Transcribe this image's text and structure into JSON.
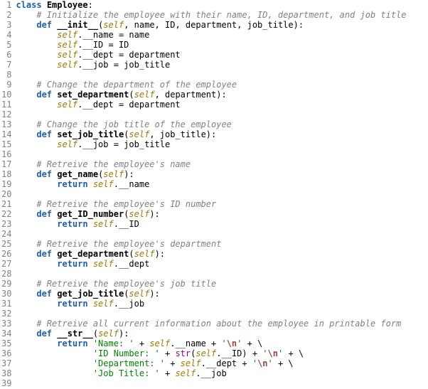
{
  "lines": [
    {
      "num": "1",
      "tokens": [
        [
          "kw",
          "class "
        ],
        [
          "cls",
          "Employee"
        ],
        [
          "plain",
          ":"
        ]
      ]
    },
    {
      "num": "2",
      "tokens": [
        [
          "plain",
          "    "
        ],
        [
          "cmt",
          "# Initialize the employee with their name, ID, department, and job title"
        ]
      ]
    },
    {
      "num": "3",
      "tokens": [
        [
          "plain",
          "    "
        ],
        [
          "kw",
          "def "
        ],
        [
          "fn",
          "__init__"
        ],
        [
          "plain",
          "("
        ],
        [
          "self",
          "self"
        ],
        [
          "plain",
          ", name, ID, department, job_title):"
        ]
      ]
    },
    {
      "num": "4",
      "tokens": [
        [
          "plain",
          "        "
        ],
        [
          "self",
          "self"
        ],
        [
          "plain",
          ".__name = name"
        ]
      ]
    },
    {
      "num": "5",
      "tokens": [
        [
          "plain",
          "        "
        ],
        [
          "self",
          "self"
        ],
        [
          "plain",
          ".__ID = ID"
        ]
      ]
    },
    {
      "num": "6",
      "tokens": [
        [
          "plain",
          "        "
        ],
        [
          "self",
          "self"
        ],
        [
          "plain",
          ".__dept = department"
        ]
      ]
    },
    {
      "num": "7",
      "tokens": [
        [
          "plain",
          "        "
        ],
        [
          "self",
          "self"
        ],
        [
          "plain",
          ".__job = job_title"
        ]
      ]
    },
    {
      "num": "8",
      "tokens": [
        [
          "plain",
          ""
        ]
      ]
    },
    {
      "num": "9",
      "tokens": [
        [
          "plain",
          "    "
        ],
        [
          "cmt",
          "# Change the department of the employee"
        ]
      ]
    },
    {
      "num": "10",
      "tokens": [
        [
          "plain",
          "    "
        ],
        [
          "kw",
          "def "
        ],
        [
          "fn",
          "set_department"
        ],
        [
          "plain",
          "("
        ],
        [
          "self",
          "self"
        ],
        [
          "plain",
          ", department):"
        ]
      ]
    },
    {
      "num": "11",
      "tokens": [
        [
          "plain",
          "        "
        ],
        [
          "self",
          "self"
        ],
        [
          "plain",
          ".__dept = department"
        ]
      ]
    },
    {
      "num": "12",
      "tokens": [
        [
          "plain",
          ""
        ]
      ]
    },
    {
      "num": "13",
      "tokens": [
        [
          "plain",
          "    "
        ],
        [
          "cmt",
          "# Change the job title of the employee"
        ]
      ]
    },
    {
      "num": "14",
      "tokens": [
        [
          "plain",
          "    "
        ],
        [
          "kw",
          "def "
        ],
        [
          "fn",
          "set_job_title"
        ],
        [
          "plain",
          "("
        ],
        [
          "self",
          "self"
        ],
        [
          "plain",
          ", job_title):"
        ]
      ]
    },
    {
      "num": "15",
      "tokens": [
        [
          "plain",
          "        "
        ],
        [
          "self",
          "self"
        ],
        [
          "plain",
          ".__job = job_title"
        ]
      ]
    },
    {
      "num": "16",
      "tokens": [
        [
          "plain",
          ""
        ]
      ]
    },
    {
      "num": "17",
      "tokens": [
        [
          "plain",
          "    "
        ],
        [
          "cmt",
          "# Retreive the employee's name"
        ]
      ]
    },
    {
      "num": "18",
      "tokens": [
        [
          "plain",
          "    "
        ],
        [
          "kw",
          "def "
        ],
        [
          "fn",
          "get_name"
        ],
        [
          "plain",
          "("
        ],
        [
          "self",
          "self"
        ],
        [
          "plain",
          "):"
        ]
      ]
    },
    {
      "num": "19",
      "tokens": [
        [
          "plain",
          "        "
        ],
        [
          "kw",
          "return "
        ],
        [
          "self",
          "self"
        ],
        [
          "plain",
          ".__name"
        ]
      ]
    },
    {
      "num": "20",
      "tokens": [
        [
          "plain",
          ""
        ]
      ]
    },
    {
      "num": "21",
      "tokens": [
        [
          "plain",
          "    "
        ],
        [
          "cmt",
          "# Retreive the employee's ID number"
        ]
      ]
    },
    {
      "num": "22",
      "tokens": [
        [
          "plain",
          "    "
        ],
        [
          "kw",
          "def "
        ],
        [
          "fn",
          "get_ID_number"
        ],
        [
          "plain",
          "("
        ],
        [
          "self",
          "self"
        ],
        [
          "plain",
          "):"
        ]
      ]
    },
    {
      "num": "23",
      "tokens": [
        [
          "plain",
          "        "
        ],
        [
          "kw",
          "return "
        ],
        [
          "self",
          "self"
        ],
        [
          "plain",
          ".__ID"
        ]
      ]
    },
    {
      "num": "24",
      "tokens": [
        [
          "plain",
          ""
        ]
      ]
    },
    {
      "num": "25",
      "tokens": [
        [
          "plain",
          "    "
        ],
        [
          "cmt",
          "# Retreive the employee's department"
        ]
      ]
    },
    {
      "num": "26",
      "tokens": [
        [
          "plain",
          "    "
        ],
        [
          "kw",
          "def "
        ],
        [
          "fn",
          "get_department"
        ],
        [
          "plain",
          "("
        ],
        [
          "self",
          "self"
        ],
        [
          "plain",
          "):"
        ]
      ]
    },
    {
      "num": "27",
      "tokens": [
        [
          "plain",
          "        "
        ],
        [
          "kw",
          "return "
        ],
        [
          "self",
          "self"
        ],
        [
          "plain",
          ".__dept"
        ]
      ]
    },
    {
      "num": "28",
      "tokens": [
        [
          "plain",
          ""
        ]
      ]
    },
    {
      "num": "29",
      "tokens": [
        [
          "plain",
          "    "
        ],
        [
          "cmt",
          "# Retreive the employee's job title"
        ]
      ]
    },
    {
      "num": "30",
      "tokens": [
        [
          "plain",
          "    "
        ],
        [
          "kw",
          "def "
        ],
        [
          "fn",
          "get_job_title"
        ],
        [
          "plain",
          "("
        ],
        [
          "self",
          "self"
        ],
        [
          "plain",
          "):"
        ]
      ]
    },
    {
      "num": "31",
      "tokens": [
        [
          "plain",
          "        "
        ],
        [
          "kw",
          "return "
        ],
        [
          "self",
          "self"
        ],
        [
          "plain",
          ".__job"
        ]
      ]
    },
    {
      "num": "32",
      "tokens": [
        [
          "plain",
          ""
        ]
      ]
    },
    {
      "num": "33",
      "tokens": [
        [
          "plain",
          "    "
        ],
        [
          "cmt",
          "# Retreive all current information about the employee in printable form"
        ]
      ]
    },
    {
      "num": "34",
      "tokens": [
        [
          "plain",
          "    "
        ],
        [
          "kw",
          "def "
        ],
        [
          "fn",
          "__str__"
        ],
        [
          "plain",
          "("
        ],
        [
          "self",
          "self"
        ],
        [
          "plain",
          "):"
        ]
      ]
    },
    {
      "num": "35",
      "tokens": [
        [
          "plain",
          "        "
        ],
        [
          "kw",
          "return "
        ],
        [
          "str",
          "'Name: '"
        ],
        [
          "plain",
          " + "
        ],
        [
          "self",
          "self"
        ],
        [
          "plain",
          ".__name + "
        ],
        [
          "str",
          "'"
        ],
        [
          "esc",
          "\\n"
        ],
        [
          "str",
          "'"
        ],
        [
          "plain",
          " + \\"
        ]
      ]
    },
    {
      "num": "36",
      "tokens": [
        [
          "plain",
          "               "
        ],
        [
          "str",
          "'ID Number: '"
        ],
        [
          "plain",
          " + "
        ],
        [
          "builtin",
          "str"
        ],
        [
          "plain",
          "("
        ],
        [
          "self",
          "self"
        ],
        [
          "plain",
          ".__ID) + "
        ],
        [
          "str",
          "'"
        ],
        [
          "esc",
          "\\n"
        ],
        [
          "str",
          "'"
        ],
        [
          "plain",
          " + \\"
        ]
      ]
    },
    {
      "num": "37",
      "tokens": [
        [
          "plain",
          "               "
        ],
        [
          "str",
          "'Department: '"
        ],
        [
          "plain",
          " + "
        ],
        [
          "self",
          "self"
        ],
        [
          "plain",
          ".__dept + "
        ],
        [
          "str",
          "'"
        ],
        [
          "esc",
          "\\n"
        ],
        [
          "str",
          "'"
        ],
        [
          "plain",
          " + \\"
        ]
      ]
    },
    {
      "num": "38",
      "tokens": [
        [
          "plain",
          "               "
        ],
        [
          "str",
          "'Job Title: '"
        ],
        [
          "plain",
          " + "
        ],
        [
          "self",
          "self"
        ],
        [
          "plain",
          ".__job"
        ]
      ]
    },
    {
      "num": "39",
      "tokens": [
        [
          "plain",
          ""
        ]
      ]
    }
  ]
}
